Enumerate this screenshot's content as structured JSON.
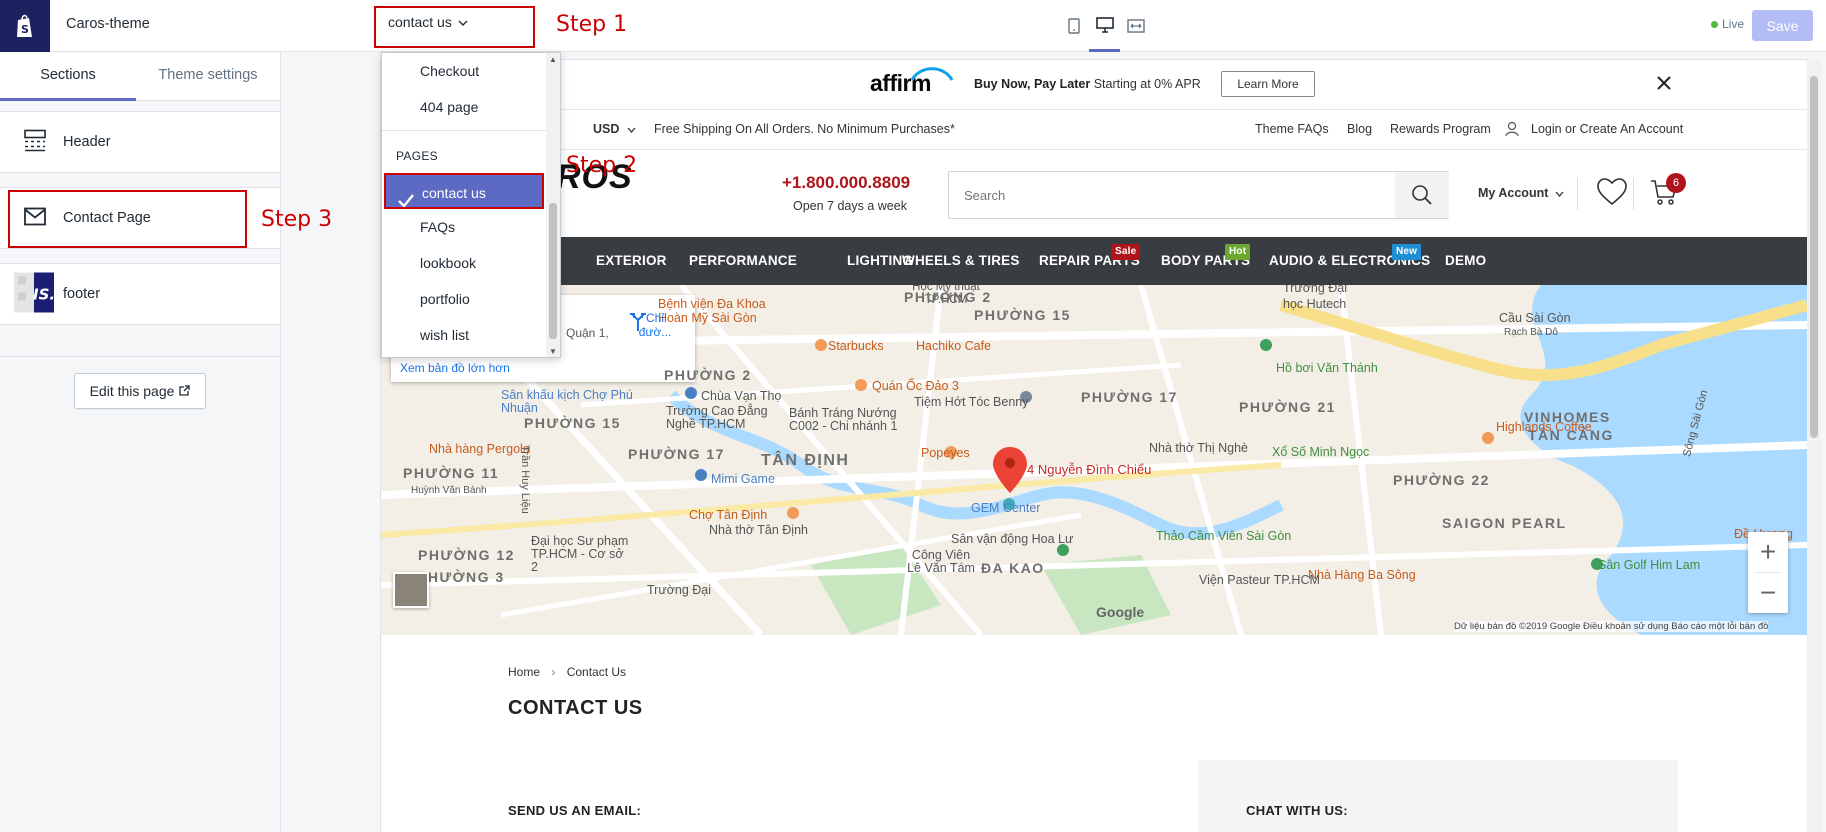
{
  "left_panel": {
    "theme_name": "Caros-theme",
    "tabs": [
      "Sections",
      "Theme settings"
    ],
    "sections": [
      {
        "label": "Header",
        "icon": "header-layout-icon"
      },
      {
        "label": "Contact Page",
        "icon": "envelope-icon"
      },
      {
        "label": "footer",
        "icon": "payment-logo-icon"
      }
    ],
    "edit_page_label": "Edit this page",
    "colors": {
      "brand": "#1c2260",
      "accent": "#5c6ac4"
    }
  },
  "topbar": {
    "page_selector_value": "contact us",
    "device_icons": [
      "mobile-icon",
      "desktop-icon",
      "fullwidth-icon"
    ],
    "status_label": "Live",
    "save_label": "Save"
  },
  "dropdown": {
    "items_top": [
      "Checkout",
      "404 page"
    ],
    "group_label": "PAGES",
    "selected": "contact us",
    "items_bottom": [
      "FAQs",
      "lookbook",
      "portfolio",
      "wish list"
    ]
  },
  "annotations": {
    "step1": "Step 1",
    "step2": "Step 2",
    "step3": "Step 3",
    "color": "#cc0000"
  },
  "preview": {
    "affirm": {
      "logo": "affirm",
      "promo_bold": "Buy Now, Pay Later",
      "promo_rest": " Starting at 0% APR",
      "learn_more": "Learn More"
    },
    "util": {
      "currency": "USD",
      "shipping": "Free Shipping On All Orders. No Minimum Purchases*",
      "links": [
        "Theme FAQs",
        "Blog",
        "Rewards Program",
        "Login or Create An Account"
      ]
    },
    "header": {
      "logo_fragment": "ROS",
      "phone": "+1.800.000.8809",
      "hours": "Open 7 days a week",
      "search_placeholder": "Search",
      "account": "My Account",
      "cart_count": "6"
    },
    "nav": {
      "items": [
        "R",
        "EXTERIOR",
        "PERFORMANCE",
        "LIGHTING",
        "WHEELS & TIRES",
        "REPAIR PARTS",
        "BODY PARTS",
        "AUDIO & ELECTRONICS",
        "DEMO"
      ],
      "badges": [
        {
          "label": "Sale",
          "color": "#b0141b"
        },
        {
          "label": "Hot",
          "color": "#6aa82f"
        },
        {
          "label": "New",
          "color": "#1e8fd6"
        }
      ],
      "background": "#393d42"
    },
    "map": {
      "card_address": "Quận 1,",
      "directions": "Chỉ đườ...",
      "bigger_map": "Xem bản đồ lớn hơn",
      "marker_label": "4 Nguyễn Đình Chiểu",
      "districts": [
        "PHƯỜNG 2",
        "PHƯỜNG 15",
        "PHƯỜNG 2",
        "PHƯỜNG 17",
        "PHƯỜNG 21",
        "PHƯỜNG 15",
        "PHƯỜNG 17",
        "TÂN ĐỊNH",
        "PHƯỜNG 11",
        "PHƯỜNG 22",
        "SAIGON PEARL",
        "PHƯỜNG 12",
        "PHƯỜNG 3",
        "ĐA KAO",
        "VINHOMES",
        "TÂN CẢNG"
      ],
      "places": [
        "Bệnh viện Đa Khoa Hoàn Mỹ Sài Gòn",
        "Starbucks",
        "Hachiko Cafe",
        "Quán Ốc Đảo 3",
        "Chùa Vạn Thọ",
        "Tiệm Hớt Tóc Benny",
        "Hồ bơi Văn Thánh",
        "Highlands Coffee",
        "Cầu Sài Gòn",
        "Rạch Bà Dô",
        "Sân khấu kịch Chợ Phú Nhuận",
        "Trường Cao Đẳng Nghề TP.HCM",
        "Bánh Tráng Nướng C002 - Chi nhánh 1",
        "Nhà hàng Pergola",
        "Mimi Game",
        "Popeyes",
        "Nhà thờ Thị Nghè",
        "Xổ Số Minh Ngọc",
        "GEM Center",
        "Chợ Tân Định",
        "Nhà thờ Tân Định",
        "Công Viên Lê Văn Tám",
        "Sân vận động Hoa Lư",
        "Thảo Cầm Viên Sài Gòn",
        "Đại học Sư phạm TP.HCM - Cơ sở 2",
        "Nhà Hàng Ba Sông",
        "Sân Golf Him Lam",
        "Đề Hương",
        "Viện Pasteur TP.HCM",
        "Trường Đại",
        "học Hutech",
        "Học My thuật TP.HCM",
        "Trần Huy Liệu",
        "Huỳnh Văn Bánh",
        "Sông Sài Gòn"
      ],
      "footer": "Dữ liệu bản đồ ©2019 Google   Điều khoản sử dụng   Báo cáo một lỗi bản đồ",
      "google": "Google",
      "zoom_in": "+",
      "zoom_out": "−"
    },
    "content": {
      "breadcrumb_home": "Home",
      "breadcrumb_current": "Contact Us",
      "title": "CONTACT US",
      "send_email": "SEND US AN EMAIL:",
      "chat": "CHAT WITH US:"
    }
  }
}
